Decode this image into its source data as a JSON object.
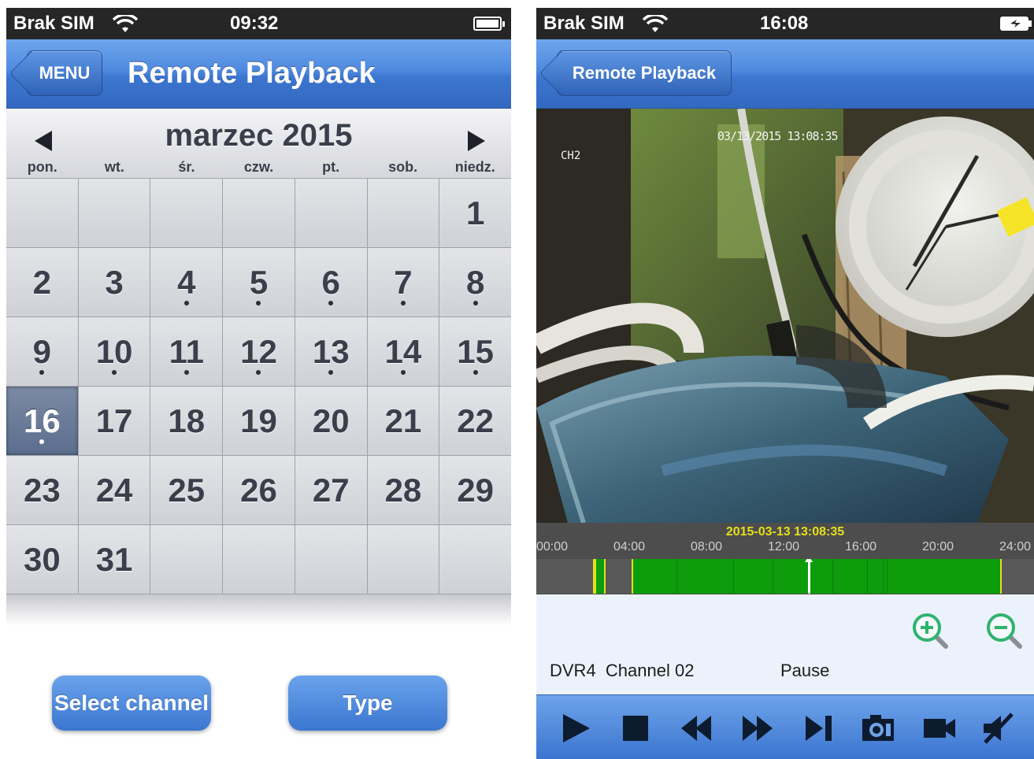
{
  "left_screen": {
    "status": {
      "carrier": "Brak SIM",
      "time": "09:32",
      "battery_level": 0.85
    },
    "nav": {
      "back_label": "MENU",
      "title": "Remote Playback"
    },
    "calendar": {
      "month_label": "marzec 2015",
      "prev_icon": "triangle-left-icon",
      "next_icon": "triangle-right-icon",
      "weekdays": [
        "pon.",
        "wt.",
        "śr.",
        "czw.",
        "pt.",
        "sob.",
        "niedz."
      ],
      "weeks": [
        [
          "",
          "",
          "",
          "",
          "",
          "",
          "1"
        ],
        [
          "2",
          "3",
          "4",
          "5",
          "6",
          "7",
          "8"
        ],
        [
          "9",
          "10",
          "11",
          "12",
          "13",
          "14",
          "15"
        ],
        [
          "16",
          "17",
          "18",
          "19",
          "20",
          "21",
          "22"
        ],
        [
          "23",
          "24",
          "25",
          "26",
          "27",
          "28",
          "29"
        ],
        [
          "30",
          "31",
          "",
          "",
          "",
          "",
          ""
        ]
      ],
      "days_with_recordings": [
        "4",
        "5",
        "6",
        "7",
        "8",
        "9",
        "10",
        "11",
        "12",
        "13",
        "14",
        "15",
        "16"
      ],
      "selected_day": "16"
    },
    "buttons": {
      "select_channel": "Select channel",
      "type": "Type"
    }
  },
  "right_screen": {
    "status": {
      "carrier": "Brak SIM",
      "time": "16:08",
      "battery_state": "charging"
    },
    "nav": {
      "back_label": "Remote Playback"
    },
    "video": {
      "timestamp_overlay": "03/13/2015 13:08:35",
      "channel_overlay": "CH2"
    },
    "timeline": {
      "current_time": "2015-03-13 13:08:35",
      "ticks": [
        "00:00",
        "04:00",
        "08:00",
        "12:00",
        "16:00",
        "20:00",
        "24:00"
      ]
    },
    "info": {
      "device_channel": "DVR4  Channel 02",
      "state": "Pause"
    },
    "zoom": {
      "in_icon": "zoom-in-icon",
      "out_icon": "zoom-out-icon"
    },
    "toolbar": [
      "play-icon",
      "stop-icon",
      "rewind-icon",
      "fast-forward-icon",
      "skip-end-icon",
      "snapshot-camera-icon",
      "record-video-icon",
      "mute-speaker-icon"
    ]
  },
  "colors": {
    "nav_blue": "#4f8ae0",
    "timeline_green": "#0c9c0c",
    "timeline_highlight": "#e7df1c"
  }
}
